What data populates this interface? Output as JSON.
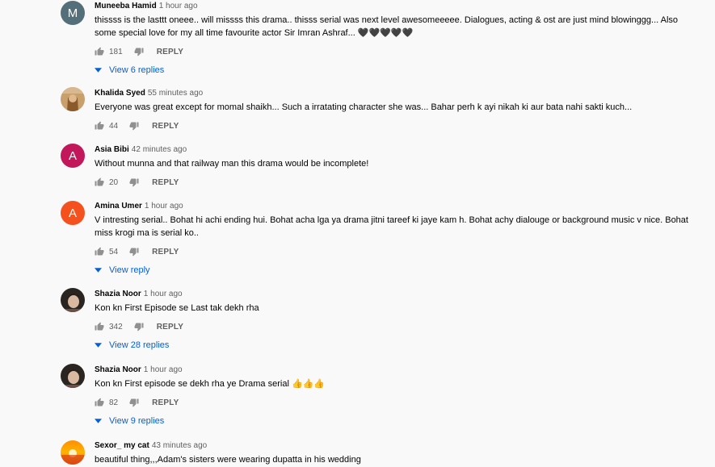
{
  "comments": [
    {
      "author": "Muneeba Hamid",
      "time": "1 hour ago",
      "avatar_letter": "M",
      "text": "thissss is the lasttt oneee.. will missss this drama.. thisss serial was next level awesomeeeee. Dialogues, acting & ost are just mind blowinggg... Also some special love for my all time favourite actor Sir Imran Ashraf... 🖤🖤🖤🖤🖤",
      "likes": "181",
      "reply_label": "REPLY",
      "view_replies": "View 6 replies"
    },
    {
      "author": "Khalida Syed",
      "time": "55 minutes ago",
      "text": "Everyone was great except for momal shaikh... Such a irratating character she was... Bahar perh k ayi nikah ki aur bata nahi sakti kuch...",
      "likes": "44",
      "reply_label": "REPLY"
    },
    {
      "author": "Asia Bibi",
      "time": "42 minutes ago",
      "avatar_letter": "A",
      "text": "Without munna and that railway man this drama would be incomplete!",
      "likes": "20",
      "reply_label": "REPLY"
    },
    {
      "author": "Amina Umer",
      "time": "1 hour ago",
      "avatar_letter": "A",
      "text": "V intresting serial.. Bohat hi achi ending hui. Bohat acha lga ya drama jitni tareef ki jaye kam h. Bohat achy dialouge or background music v nice. Bohat miss krogi ma is serial ko..",
      "likes": "54",
      "reply_label": "REPLY",
      "view_replies": "View reply"
    },
    {
      "author": "Shazia Noor",
      "time": "1 hour ago",
      "text": "Kon kn First Episode se Last tak dekh rha",
      "likes": "342",
      "reply_label": "REPLY",
      "view_replies": "View 28 replies"
    },
    {
      "author": "Shazia Noor",
      "time": "1 hour ago",
      "text": "Kon kn First episode se dekh rha ye Drama serial 👍👍👍",
      "likes": "82",
      "reply_label": "REPLY",
      "view_replies": "View 9 replies"
    },
    {
      "author": "Sexor_ my cat",
      "time": "43 minutes ago",
      "text": "beautiful thing,,,Adam's sisters were wearing dupatta in his wedding"
    }
  ],
  "colors": {
    "background": "#f9f9f9",
    "link_blue": "#065fd4",
    "muted_text": "#606060",
    "avatar_muneeba": "#546e7a",
    "avatar_asia": "#c2185b",
    "avatar_amina": "#f4511e"
  },
  "icons": {
    "like": "thumbs-up-icon",
    "dislike": "thumbs-down-icon",
    "expand": "caret-down-icon"
  }
}
